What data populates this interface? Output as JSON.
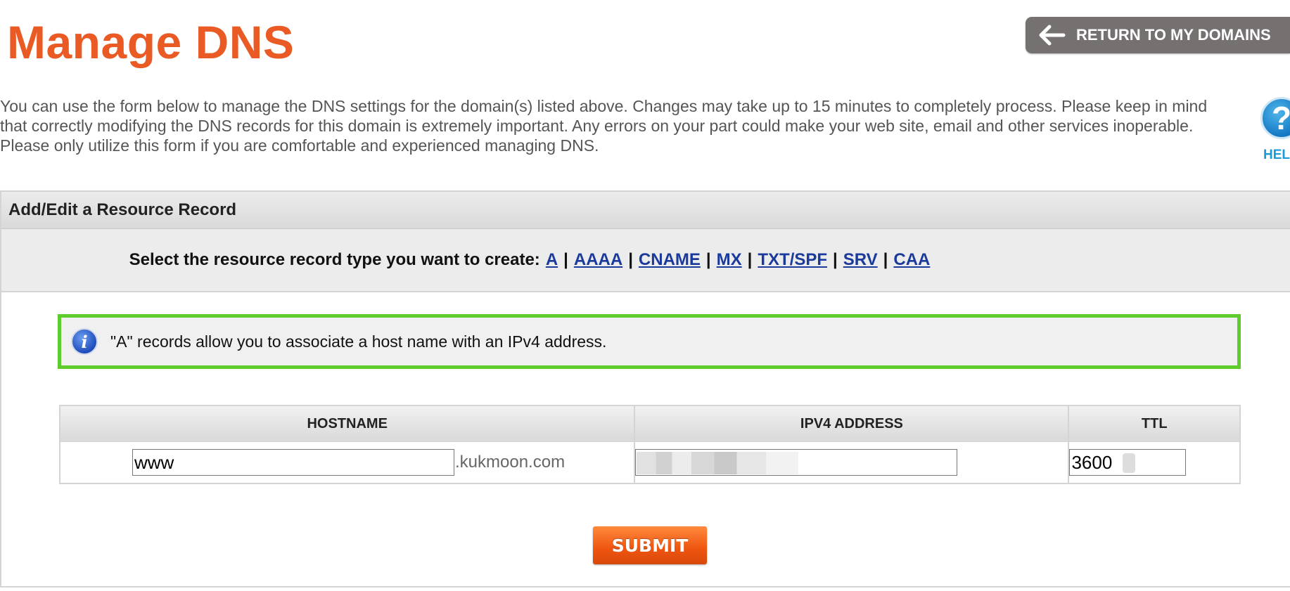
{
  "header": {
    "title": "Manage DNS",
    "return_button_label": "RETURN TO MY DOMAINS"
  },
  "intro_text": "You can use the form below to manage the DNS settings for the domain(s) listed above. Changes may take up to 15 minutes to completely process. Please keep in mind that correctly modifying the DNS records for this domain is extremely important. Any errors on your part could make your web site, email and other services inoperable. Please only utilize this form if you are comfortable and experienced managing DNS.",
  "help": {
    "icon": "?",
    "label": "HELP"
  },
  "panel": {
    "header": "Add/Edit a Resource Record",
    "type_prompt": "Select the resource record type you want to create:",
    "record_types": [
      "A",
      "AAAA",
      "CNAME",
      "MX",
      "TXT/SPF",
      "SRV",
      "CAA"
    ],
    "info_message": "\"A\" records allow you to associate a host name with an IPv4 address.",
    "table": {
      "columns": [
        "HOSTNAME",
        "IPV4 ADDRESS",
        "TTL"
      ],
      "hostname_value": "www",
      "domain_suffix": ".kukmoon.com",
      "ipv4_value": "",
      "ttl_value": "3600"
    },
    "submit_label": "SUBMIT"
  },
  "colors": {
    "title": "#ea5a24",
    "return_button": "#757171",
    "info_border": "#5fcc2e",
    "link": "#1a3a9c",
    "submit": "#ee5410"
  }
}
